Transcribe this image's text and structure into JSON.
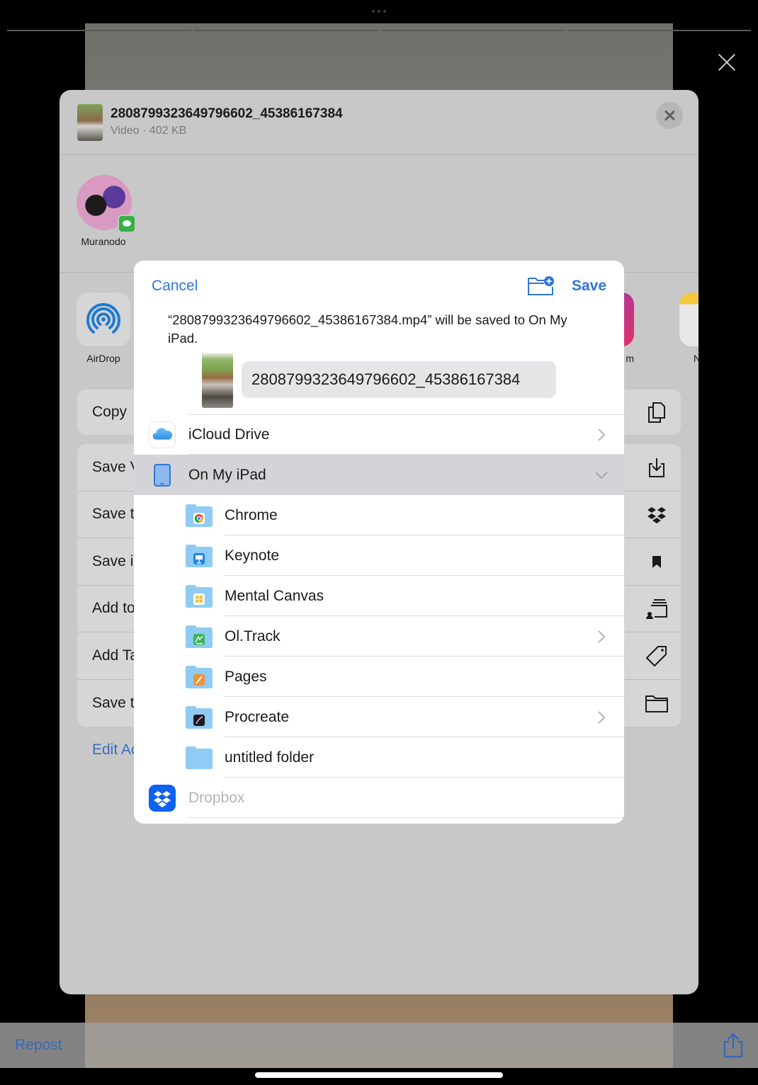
{
  "background": {
    "repost_label": "Repost",
    "icons": [
      "more-dots-icon",
      "close-icon",
      "share-icon"
    ]
  },
  "share_sheet": {
    "file_title": "2808799323649796602_45386167384",
    "file_subtitle": "Video · 402 KB",
    "contacts": [
      {
        "name": "Muranodo",
        "app_badge": "LINE"
      }
    ],
    "apps": [
      {
        "label": "AirDrop",
        "icon": "airdrop-icon"
      },
      {
        "label": "m",
        "icon": "instagram-icon"
      },
      {
        "label": "N",
        "icon": "notes-icon"
      }
    ],
    "action_groups": [
      [
        {
          "label": "Copy",
          "icon": "copy-icon"
        }
      ],
      [
        {
          "label": "Save V",
          "icon": "save-download-icon"
        },
        {
          "label": "Save t",
          "icon": "dropbox-icon"
        },
        {
          "label": "Save i",
          "icon": "bookmark-icon"
        },
        {
          "label": "Add to",
          "icon": "shared-album-icon"
        },
        {
          "label": "Add Ta",
          "icon": "tag-icon"
        },
        {
          "label": "Save t",
          "icon": "folder-icon"
        }
      ]
    ],
    "edit_actions_label": "Edit Ac"
  },
  "save_dialog": {
    "cancel_label": "Cancel",
    "save_label": "Save",
    "message": "“2808799323649796602_45386167384.mp4” will be saved to On My iPad.",
    "filename_value": "2808799323649796602_45386167384",
    "locations": [
      {
        "label": "iCloud Drive",
        "type": "top",
        "icon": "icloud-icon",
        "chevron": "right",
        "selected": false,
        "disabled": false
      },
      {
        "label": "On My iPad",
        "type": "top",
        "icon": "ipad-icon",
        "chevron": "down",
        "selected": true,
        "disabled": false
      },
      {
        "label": "Chrome",
        "type": "folder",
        "icon": "chrome-folder-icon",
        "chevron": null,
        "disabled": false
      },
      {
        "label": "Keynote",
        "type": "folder",
        "icon": "keynote-folder-icon",
        "chevron": null,
        "disabled": false
      },
      {
        "label": "Mental Canvas",
        "type": "folder",
        "icon": "mental-canvas-folder-icon",
        "chevron": null,
        "disabled": false
      },
      {
        "label": "Ol.Track",
        "type": "folder",
        "icon": "oltrack-folder-icon",
        "chevron": "right",
        "disabled": false
      },
      {
        "label": "Pages",
        "type": "folder",
        "icon": "pages-folder-icon",
        "chevron": null,
        "disabled": false
      },
      {
        "label": "Procreate",
        "type": "folder",
        "icon": "procreate-folder-icon",
        "chevron": "right",
        "disabled": false
      },
      {
        "label": "untitled folder",
        "type": "folder",
        "icon": "folder-icon",
        "chevron": null,
        "disabled": false
      },
      {
        "label": "Dropbox",
        "type": "top",
        "icon": "dropbox-icon",
        "chevron": null,
        "selected": false,
        "disabled": true
      }
    ]
  },
  "colors": {
    "accent": "#2f76d8",
    "selected_row": "#d4d4d8",
    "folder": "#8fcbf3"
  }
}
